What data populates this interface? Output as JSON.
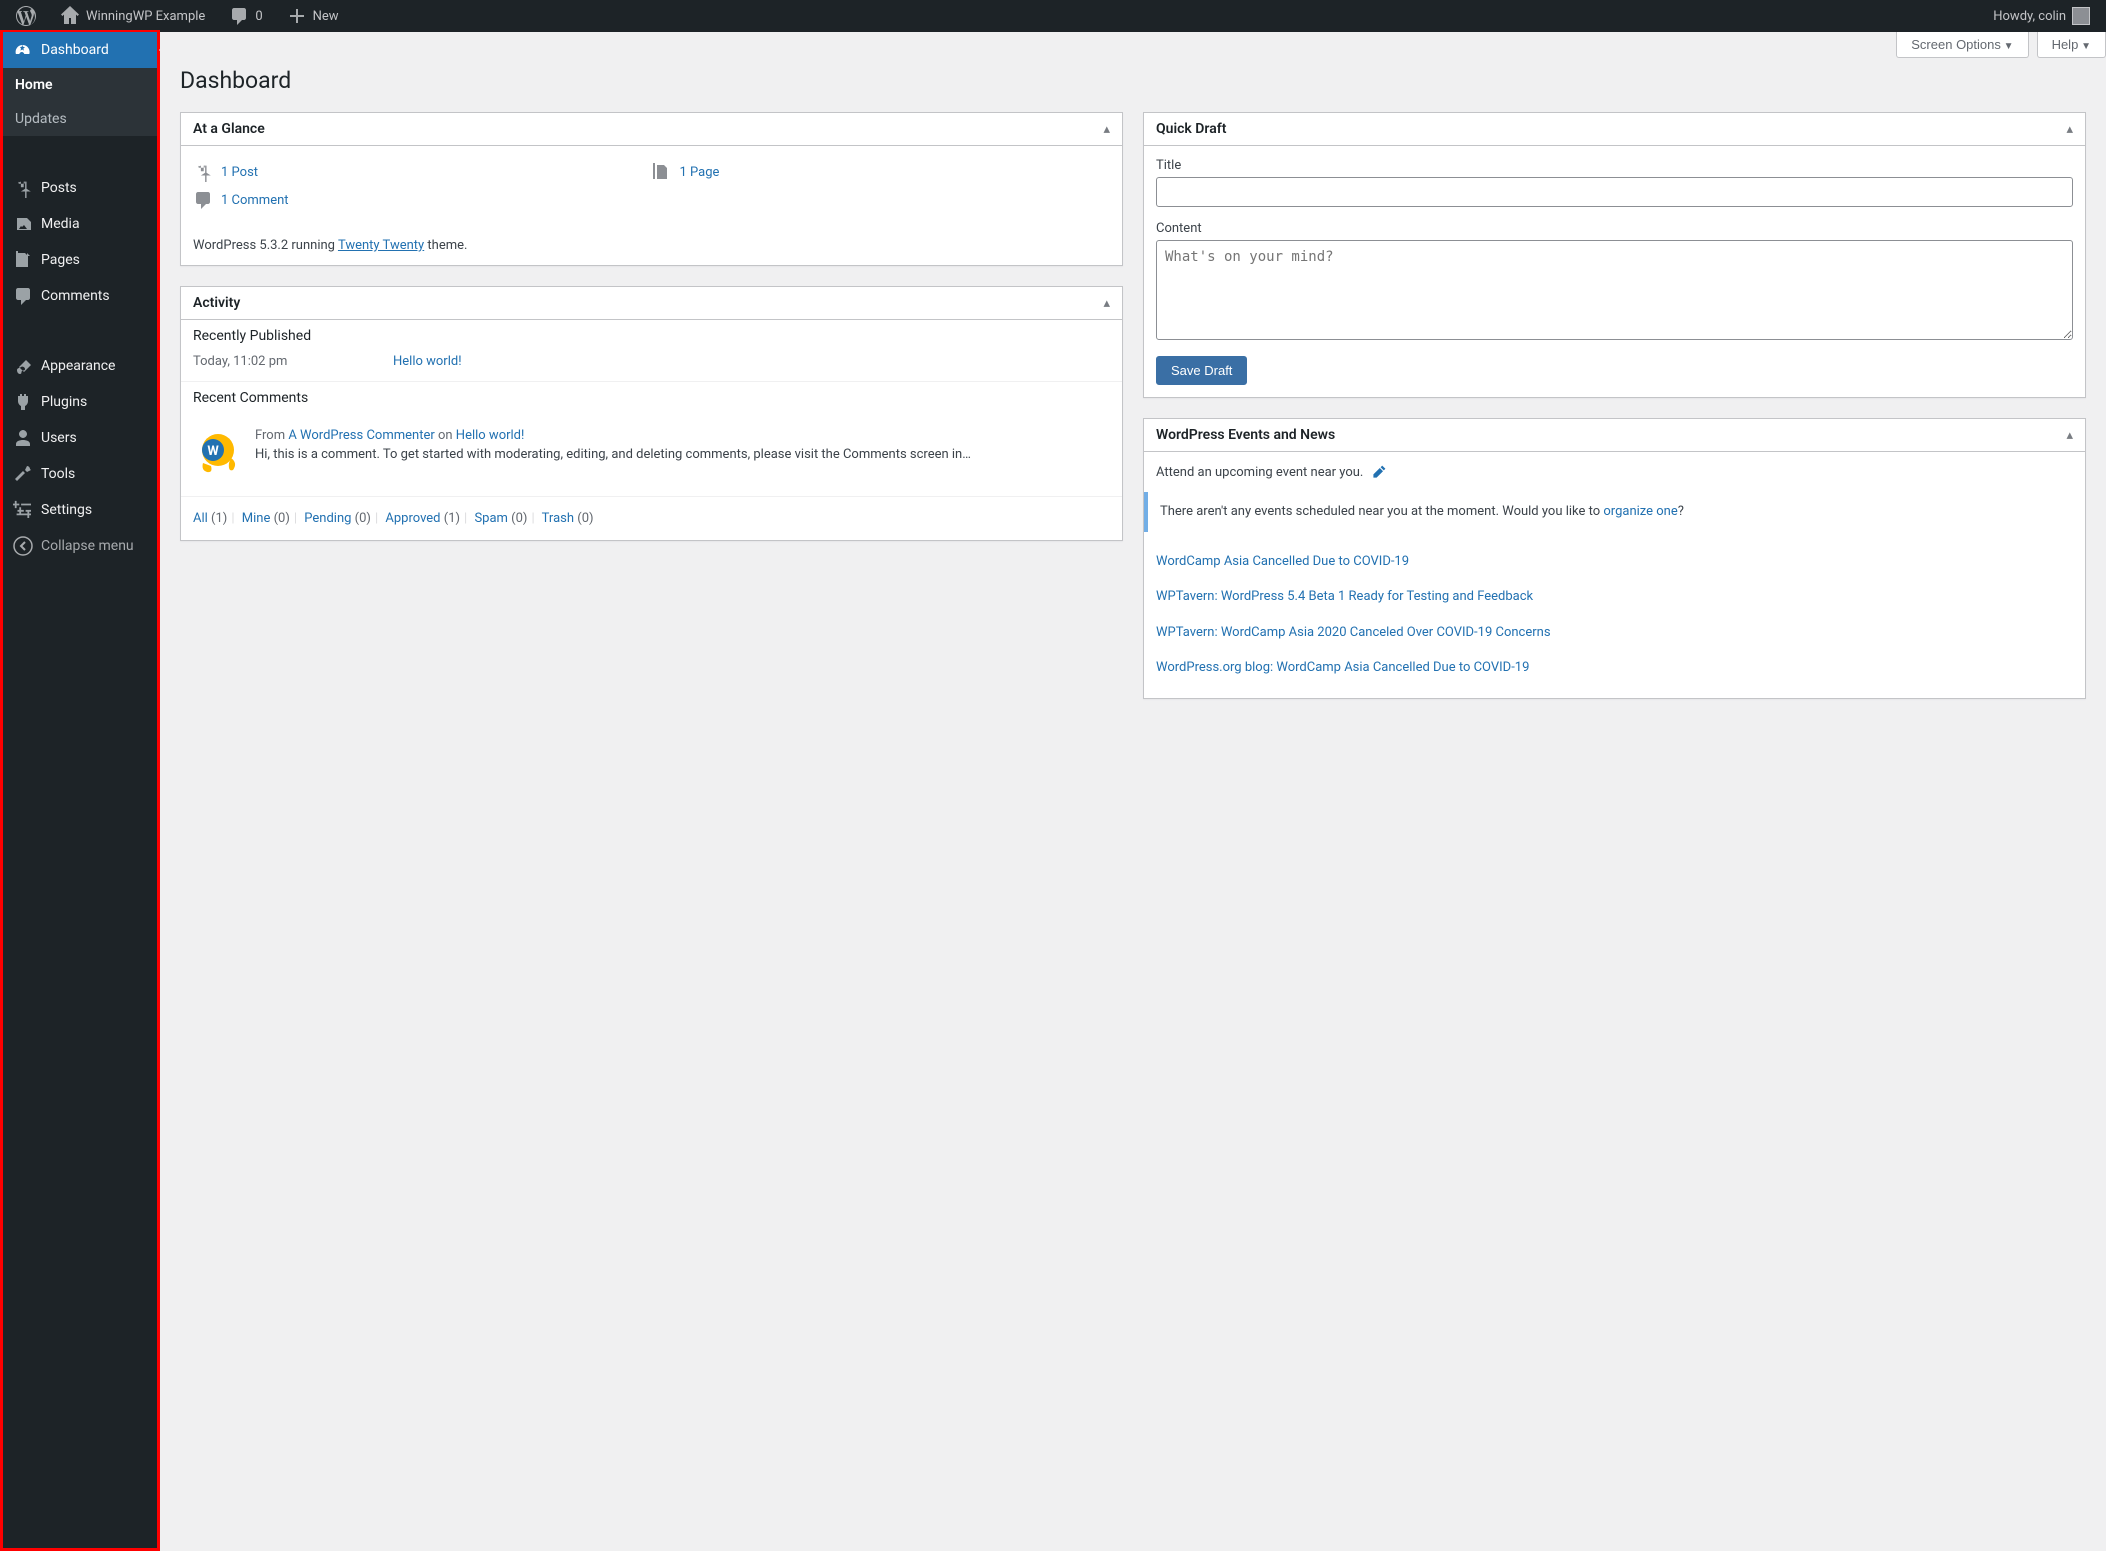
{
  "adminbar": {
    "site_name": "WinningWP Example",
    "comments_count": "0",
    "new_label": "New",
    "howdy": "Howdy, colin"
  },
  "sidebar": {
    "dashboard": "Dashboard",
    "home": "Home",
    "updates": "Updates",
    "posts": "Posts",
    "media": "Media",
    "pages": "Pages",
    "comments": "Comments",
    "appearance": "Appearance",
    "plugins": "Plugins",
    "users": "Users",
    "tools": "Tools",
    "settings": "Settings",
    "collapse": "Collapse menu"
  },
  "screen_meta": {
    "screen_options": "Screen Options",
    "help": "Help"
  },
  "page_title": "Dashboard",
  "glance": {
    "title": "At a Glance",
    "posts": "1 Post",
    "pages": "1 Page",
    "comments": "1 Comment",
    "version_pre": "WordPress 5.3.2 running ",
    "theme": "Twenty Twenty",
    "version_post": " theme."
  },
  "activity": {
    "title": "Activity",
    "recently_published": "Recently Published",
    "pub_time": "Today, 11:02 pm",
    "pub_title": "Hello world!",
    "recent_comments": "Recent Comments",
    "from_label": "From ",
    "commenter": "A WordPress Commenter",
    "on_label": " on ",
    "on_post": "Hello world!",
    "comment_text": "Hi, this is a comment. To get started with moderating, editing, and deleting comments, please visit the Comments screen in…",
    "filters": {
      "all": "All",
      "all_c": " (1)",
      "mine": "Mine",
      "mine_c": " (0)",
      "pending": "Pending",
      "pending_c": " (0)",
      "approved": "Approved",
      "approved_c": " (1)",
      "spam": "Spam",
      "spam_c": " (0)",
      "trash": "Trash",
      "trash_c": " (0)"
    }
  },
  "quickdraft": {
    "title": "Quick Draft",
    "title_label": "Title",
    "content_label": "Content",
    "placeholder": "What's on your mind?",
    "save": "Save Draft"
  },
  "events": {
    "title": "WordPress Events and News",
    "intro": "Attend an upcoming event near you.",
    "notice_pre": "There aren't any events scheduled near you at the moment. Would you like to ",
    "notice_link": "organize one",
    "notice_post": "?",
    "news": [
      "WordCamp Asia Cancelled Due to COVID-19",
      "WPTavern: WordPress 5.4 Beta 1 Ready for Testing and Feedback",
      "WPTavern: WordCamp Asia 2020 Canceled Over COVID-19 Concerns",
      "WordPress.org blog: WordCamp Asia Cancelled Due to COVID-19"
    ]
  }
}
